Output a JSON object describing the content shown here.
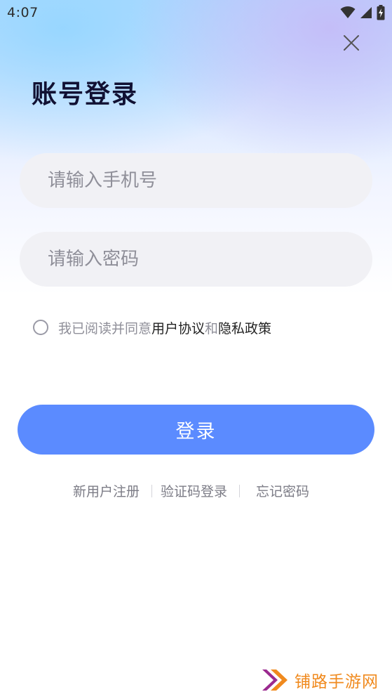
{
  "status_bar": {
    "time": "4:07",
    "icons": [
      "wifi-icon",
      "cellular-signal-icon",
      "battery-charging-icon"
    ]
  },
  "header": {
    "close_icon": "close-icon",
    "title": "账号登录"
  },
  "form": {
    "phone_placeholder": "请输入手机号",
    "phone_value": "",
    "password_placeholder": "请输入密码",
    "password_value": ""
  },
  "agreement": {
    "checked": false,
    "prefix": "我已阅读并同意",
    "user_agreement": "用户协议",
    "connector": "和",
    "privacy_policy": "隐私政策"
  },
  "login_button": {
    "label": "登录",
    "color": "#5b8bff"
  },
  "bottom_links": {
    "register": "新用户注册",
    "sms_login": "验证码登录",
    "forgot_password": "忘记密码"
  },
  "watermark": {
    "text": "铺路手游网",
    "logo_icon": "double-chevron-logo",
    "color": "#f08a1e"
  }
}
